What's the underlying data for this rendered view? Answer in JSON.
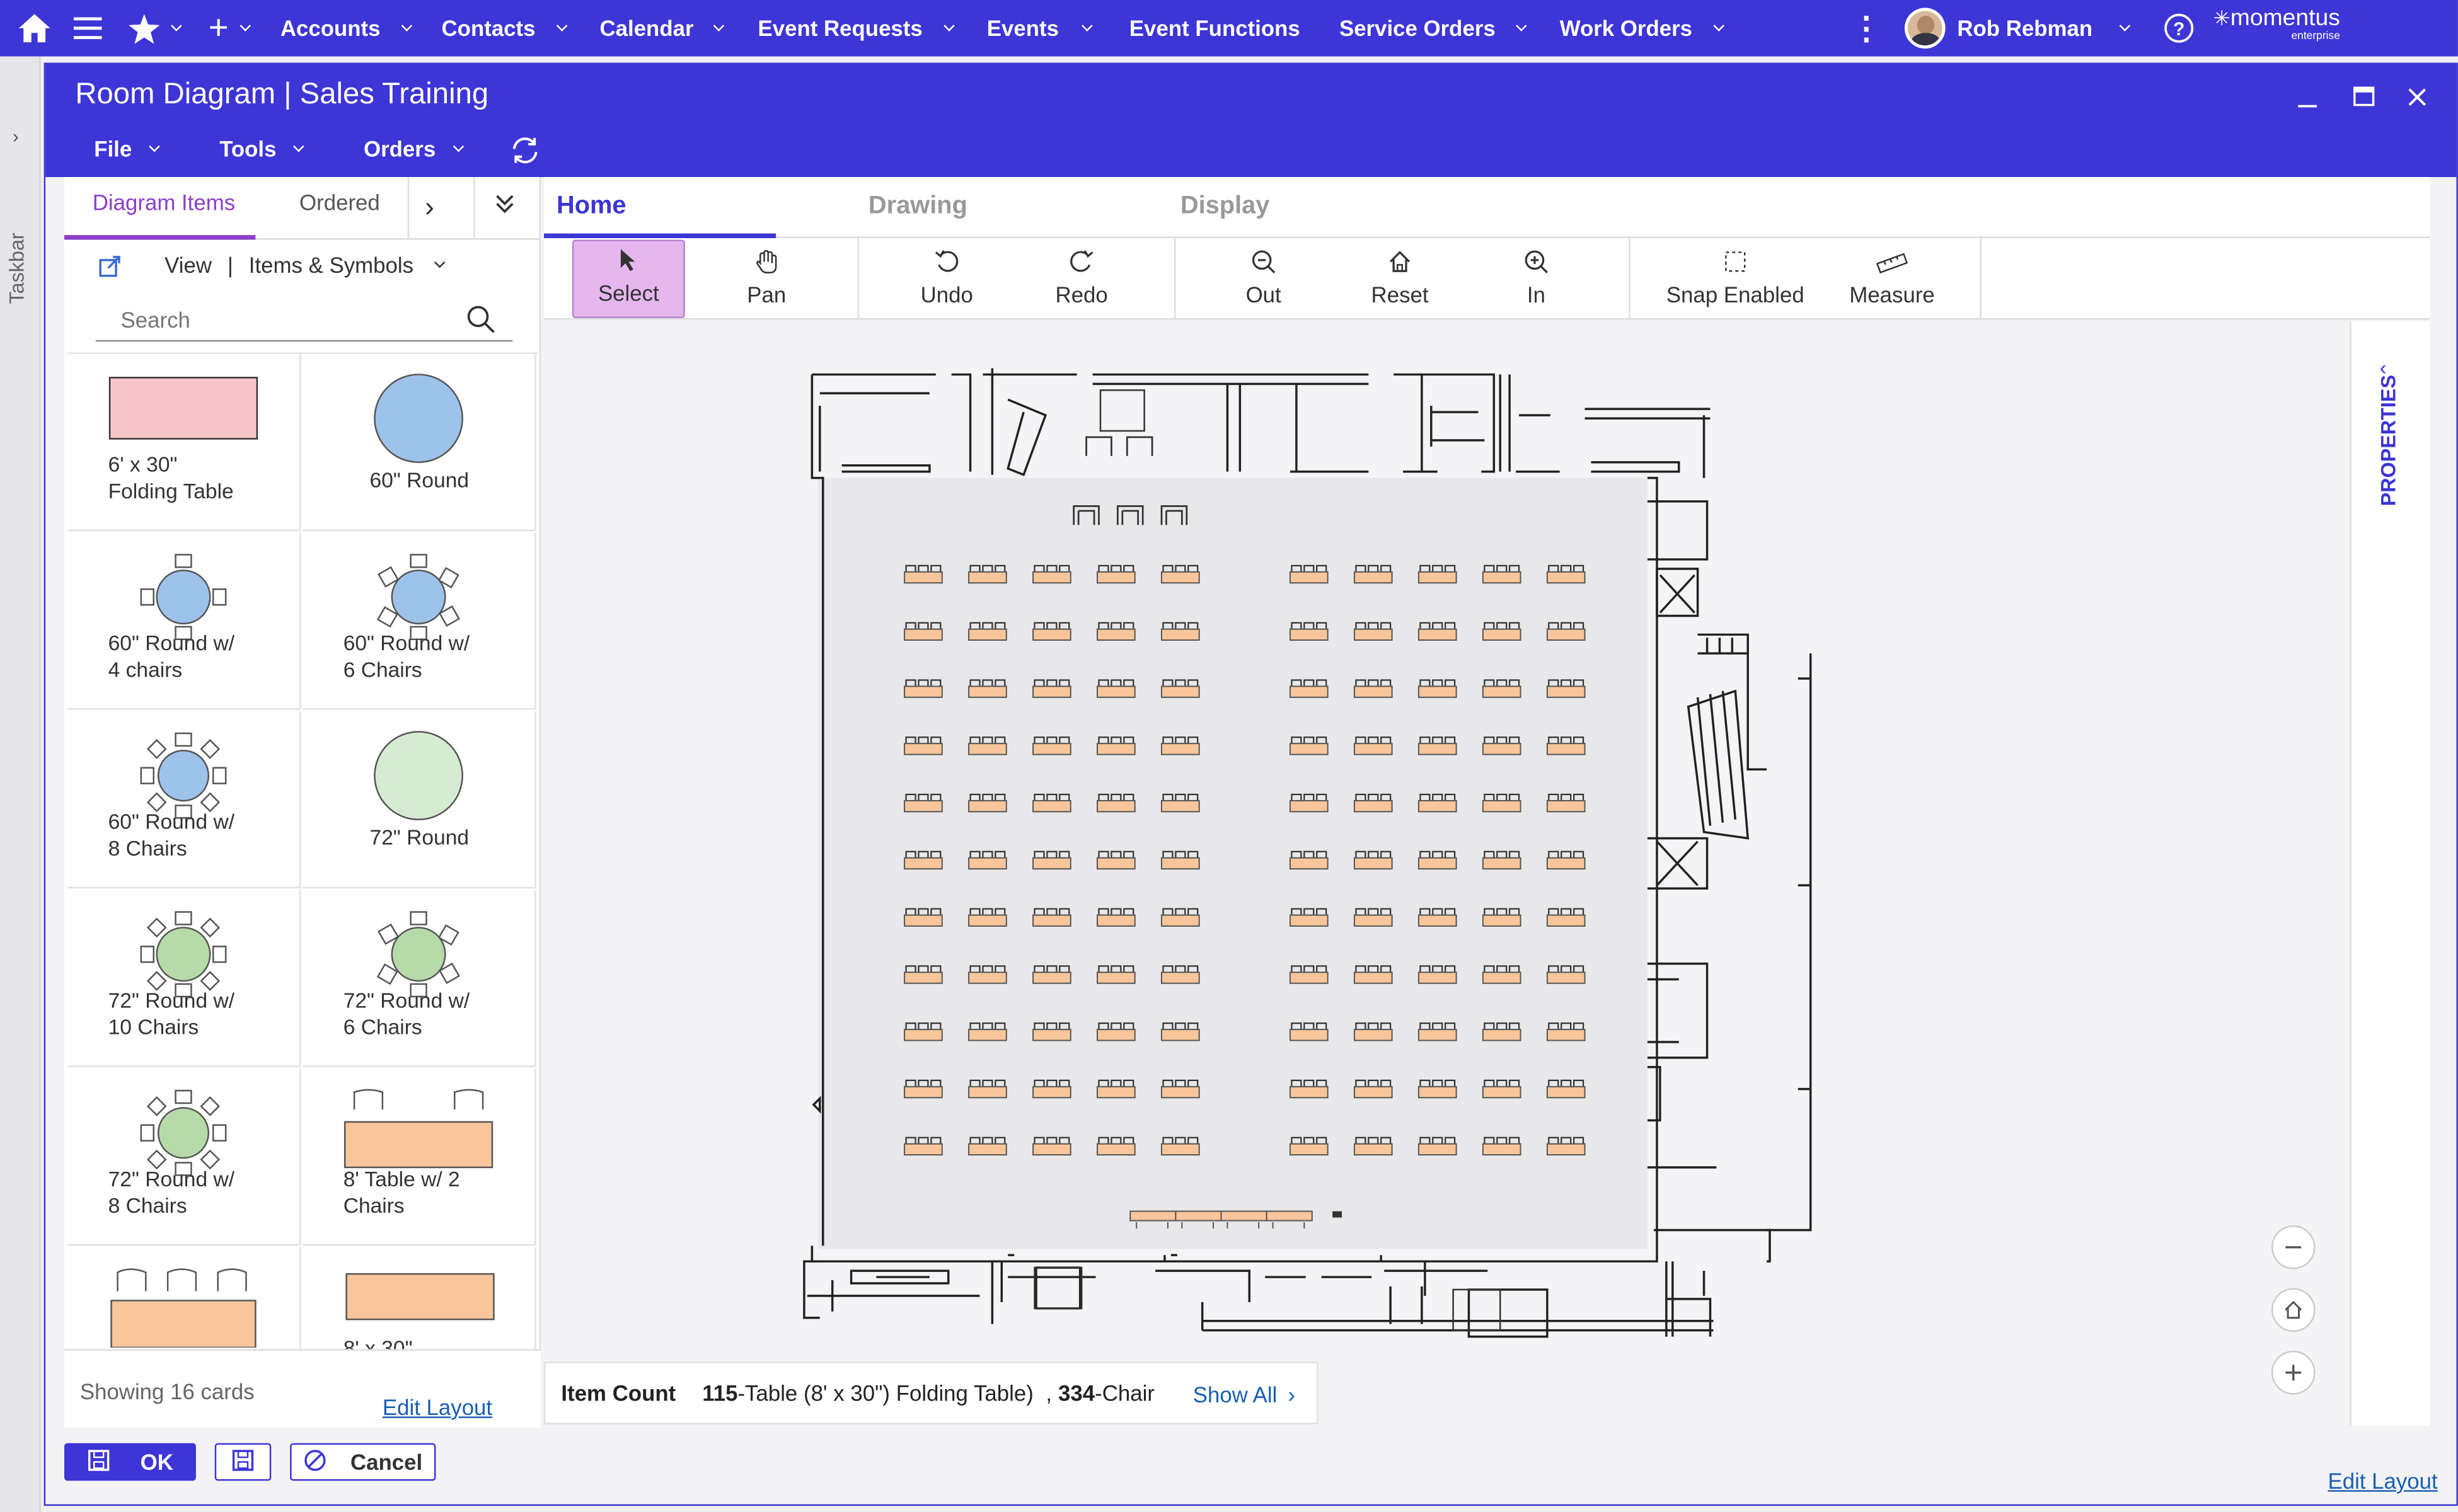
{
  "topnav": {
    "items": [
      {
        "label": "Accounts"
      },
      {
        "label": "Contacts"
      },
      {
        "label": "Calendar"
      },
      {
        "label": "Event Requests"
      },
      {
        "label": "Events"
      },
      {
        "label": "Event Functions"
      },
      {
        "label": "Service Orders"
      },
      {
        "label": "Work Orders"
      }
    ],
    "user_name": "Rob Rebman",
    "brand": "momentus",
    "brand_sub": "enterprise",
    "accent": "#3d35d6"
  },
  "taskbar": {
    "label": "Taskbar"
  },
  "window": {
    "title": "Room Diagram | Sales Training",
    "menus": [
      {
        "label": "File"
      },
      {
        "label": "Tools"
      },
      {
        "label": "Orders"
      }
    ]
  },
  "left_panel": {
    "tabs": [
      {
        "label": "Diagram Items"
      },
      {
        "label": "Ordered"
      }
    ],
    "view_label": "View",
    "view_value": "Items & Symbols",
    "search_placeholder": "Search",
    "cards": [
      {
        "label": "6' x 30\"\nFolding Table",
        "icon": "rect-table-pink"
      },
      {
        "label": "60\" Round",
        "icon": "round-blue"
      },
      {
        "label": "60\" Round w/\n4 chairs",
        "icon": "round-blue-4-chairs"
      },
      {
        "label": "60\" Round w/\n6 Chairs",
        "icon": "round-blue-6-chairs"
      },
      {
        "label": "60\" Round w/\n8 Chairs",
        "icon": "round-blue-8-chairs"
      },
      {
        "label": "72\" Round",
        "icon": "round-green"
      },
      {
        "label": "72\" Round w/\n10 Chairs",
        "icon": "round-green-10-chairs"
      },
      {
        "label": "72\" Round w/\n6 Chairs",
        "icon": "round-green-6-chairs"
      },
      {
        "label": "72\" Round w/\n8 Chairs",
        "icon": "round-green-8-chairs"
      },
      {
        "label": "8' Table w/ 2\nChairs",
        "icon": "table-2-chairs"
      },
      {
        "label": "",
        "icon": "table-3-chairs"
      },
      {
        "label": "8' x 30\"",
        "icon": "rect-table-orange"
      }
    ],
    "showing": "Showing 16 cards",
    "edit_layout": "Edit Layout"
  },
  "ribbon": {
    "tabs": [
      {
        "label": "Home"
      },
      {
        "label": "Drawing"
      },
      {
        "label": "Display"
      }
    ],
    "tools": [
      {
        "label": "Select",
        "icon": "cursor-icon"
      },
      {
        "label": "Pan",
        "icon": "hand-icon"
      },
      {
        "label": "Undo",
        "icon": "undo-icon"
      },
      {
        "label": "Redo",
        "icon": "redo-icon"
      },
      {
        "label": "Out",
        "icon": "zoom-out-icon"
      },
      {
        "label": "Reset",
        "icon": "home-icon"
      },
      {
        "label": "In",
        "icon": "zoom-in-icon"
      },
      {
        "label": "Snap Enabled",
        "icon": "snap-icon"
      },
      {
        "label": "Measure",
        "icon": "ruler-icon"
      }
    ]
  },
  "properties": {
    "label": "PROPERTIES"
  },
  "item_count": {
    "label": "Item Count",
    "table_count": "115",
    "table_text": "-Table (8' x 30\") Folding Table)",
    "sep": ",",
    "chair_count": "334",
    "chair_text": "-Chair",
    "show_all": "Show All"
  },
  "footer": {
    "ok_label": "OK",
    "cancel_label": "Cancel",
    "edit_layout": "Edit Layout"
  }
}
